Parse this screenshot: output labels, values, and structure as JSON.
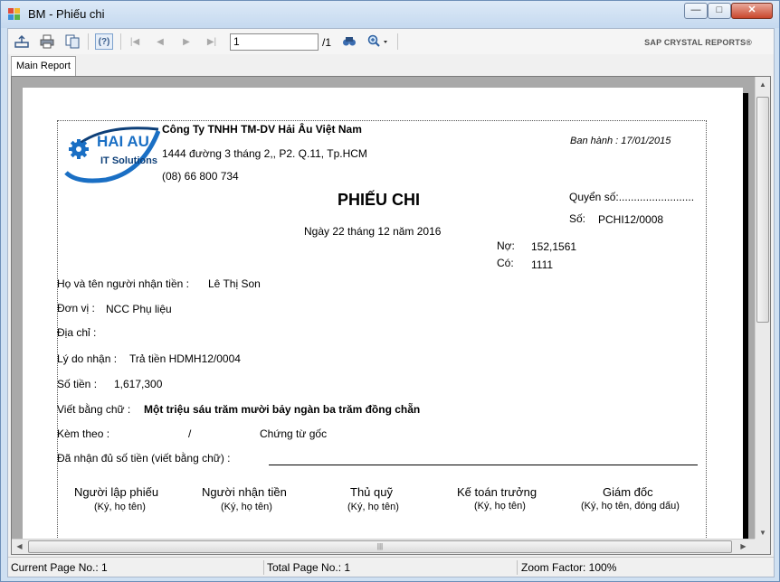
{
  "window": {
    "title": "BM - Phiếu chi",
    "minimize": "—",
    "maximize": "□",
    "close": "✕"
  },
  "toolbar": {
    "icons": [
      "export-icon",
      "print-icon",
      "copy-icon",
      "help-icon",
      "first-page-icon",
      "prev-page-icon",
      "next-page-icon",
      "last-page-icon",
      "find-icon",
      "zoom-icon"
    ],
    "page_value": "1",
    "page_total": "/1",
    "brand": "SAP CRYSTAL REPORTS®"
  },
  "tabs": [
    {
      "label": "Main Report"
    }
  ],
  "report": {
    "company_name": "Công Ty TNHH TM-DV Hải Âu Việt Nam",
    "company_address": "1444 đường 3 tháng 2,, P2. Q.11, Tp.HCM",
    "company_phone": "(08) 66 800 734",
    "logo_text": "HAI AU",
    "logo_subtext": "IT Solutions",
    "issued": "Ban hành : 17/01/2015",
    "book_label": "Quyển số:.........................",
    "number_label": "Số:",
    "number_value": "PCHI12/0008",
    "title": "PHIẾU CHI",
    "date": "Ngày 22 tháng 12 năm 2016",
    "debit_label": "Nợ:",
    "debit_value": "152,1561",
    "credit_label": "Có:",
    "credit_value": "1111",
    "recipient_label": "Họ và tên người nhận tiền :",
    "recipient_value": "Lê Thị Son",
    "unit_label": "Đơn vị :",
    "unit_value": "NCC Phụ liệu",
    "address_label": "Địa chỉ :",
    "reason_label": "Lý do nhận :",
    "reason_value": "Trả tiền HDMH12/0004",
    "amount_label": "Số tiền :",
    "amount_value": "1,617,300",
    "words_label": "Viết bằng chữ :",
    "words_value": "Một triệu sáu trăm mười bảy ngàn ba trăm đồng chẵn",
    "attach_label": "Kèm theo :",
    "attach_slash": "/",
    "attach_docs": "Chứng từ gốc",
    "received_label": "Đã nhận đủ số tiền (viết bằng chữ) :",
    "signatures": [
      {
        "title": "Người lập phiếu",
        "sub": "(Ký, họ tên)"
      },
      {
        "title": "Người nhận tiền",
        "sub": "(Ký, họ tên)"
      },
      {
        "title": "Thủ quỹ",
        "sub": "(Ký, họ tên)"
      },
      {
        "title": "Kế toán trưởng",
        "sub": "(Ký, họ tên)"
      },
      {
        "title": "Giám đốc",
        "sub": "(Ký, họ tên, đóng dấu)"
      }
    ]
  },
  "status": {
    "current_page": "Current Page No.: 1",
    "total_page": "Total Page No.: 1",
    "zoom": "Zoom Factor: 100%"
  },
  "colors": {
    "logo_blue": "#1a6fc4",
    "logo_dark": "#0d3f78"
  }
}
